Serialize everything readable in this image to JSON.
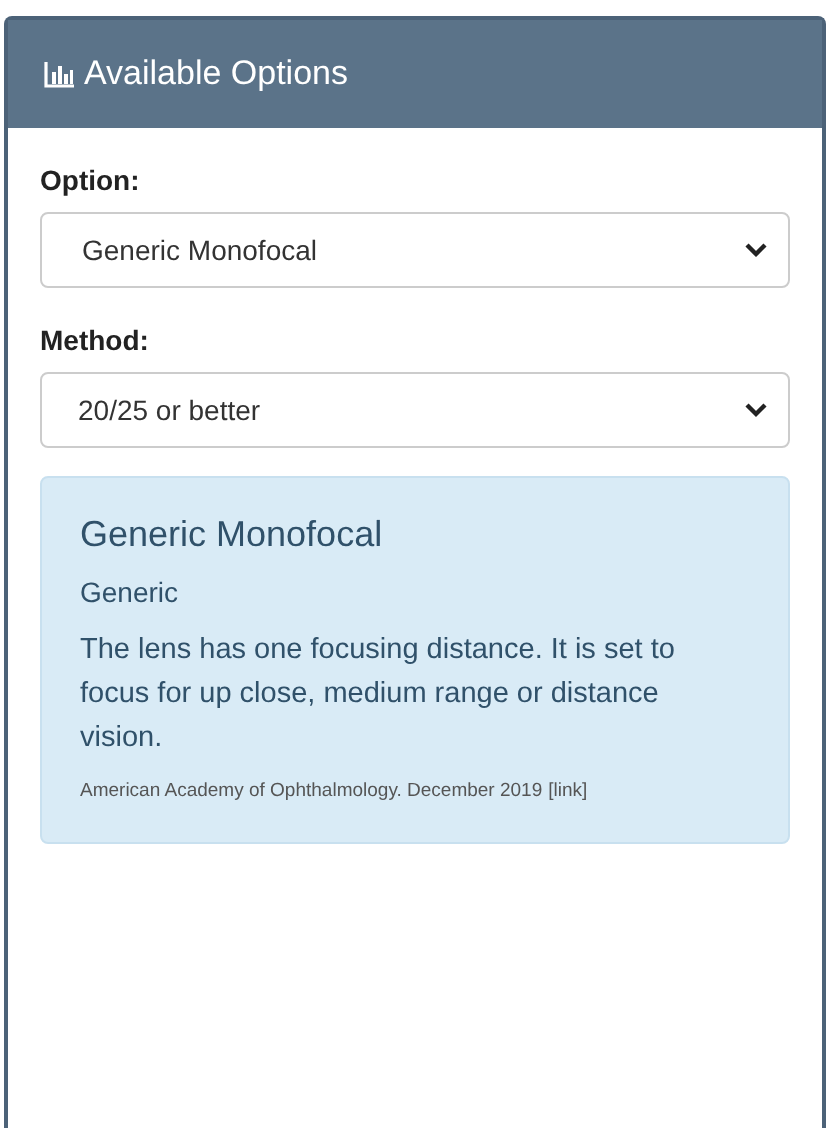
{
  "panel": {
    "title": "Available Options"
  },
  "fields": [
    {
      "label": "Option:",
      "value": "Generic Monofocal"
    },
    {
      "label": "Method:",
      "value": "20/25 or better"
    }
  ],
  "info": {
    "title": "Generic Monofocal",
    "subtitle": "Generic",
    "description": "The lens has one focusing distance. It is set to focus for up close, medium range or distance vision.",
    "citation": "American Academy of Ophthalmology. December 2019",
    "link": "[link]"
  }
}
